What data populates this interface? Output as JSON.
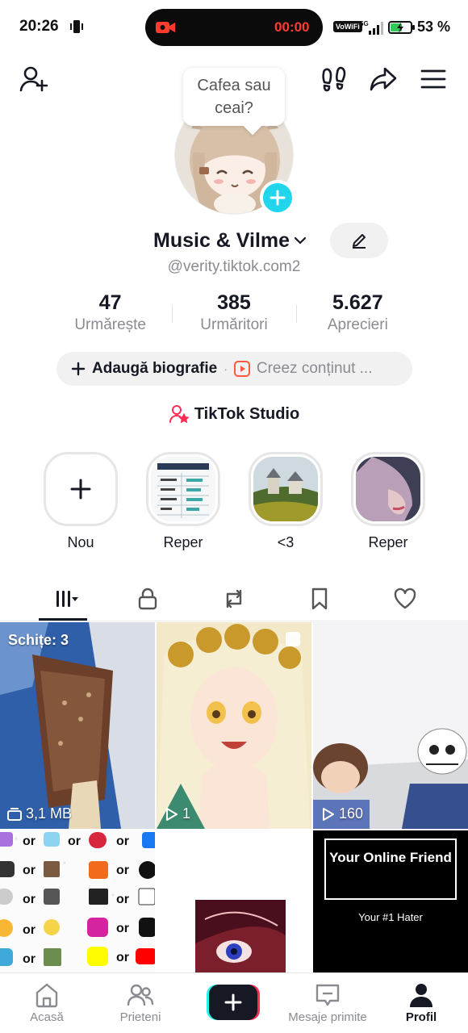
{
  "status_bar": {
    "time": "20:26",
    "recording_timer": "00:00",
    "vowifi": "VoWiFi",
    "network": "5G",
    "battery_percent": "53 %"
  },
  "header": {
    "icons": [
      "add-friend-icon",
      "footprints-icon",
      "share-icon",
      "menu-icon"
    ]
  },
  "profile": {
    "note_bubble": "Cafea sau ceai?",
    "display_name": "Music & Vilme",
    "handle": "@verity.tiktok.com2",
    "stats": [
      {
        "value": "47",
        "label": "Urmărește"
      },
      {
        "value": "385",
        "label": "Urmăritori"
      },
      {
        "value": "5.627",
        "label": "Aprecieri"
      }
    ],
    "add_bio": "Adaugă biografie",
    "creator_text": "Creez conținut ...",
    "studio": "TikTok Studio"
  },
  "highlights": [
    {
      "label": "Nou"
    },
    {
      "label": "Reper"
    },
    {
      "label": "<3"
    },
    {
      "label": "Reper"
    }
  ],
  "tabs": [
    "videos-grid-icon",
    "lock-icon",
    "repost-icon",
    "bookmark-icon",
    "heart-icon"
  ],
  "grid": {
    "drafts": "Schițe: 3",
    "drafts_size": "3,1 MB",
    "video2_views": "1",
    "video3_views": "160",
    "friend_title": "Your Online Friend",
    "friend_sub": "Your #1 Hater",
    "or_word": "or"
  },
  "bottom_nav": [
    {
      "label": "Acasă"
    },
    {
      "label": "Prieteni"
    },
    {
      "label": "Mesaje primite"
    },
    {
      "label": "Profil"
    }
  ],
  "colors": {
    "accent_cyan": "#25f4ee",
    "accent_red": "#fe2c55",
    "plus_badge": "#20d5ec",
    "text_primary": "#161823",
    "text_secondary": "#8a8b91"
  }
}
